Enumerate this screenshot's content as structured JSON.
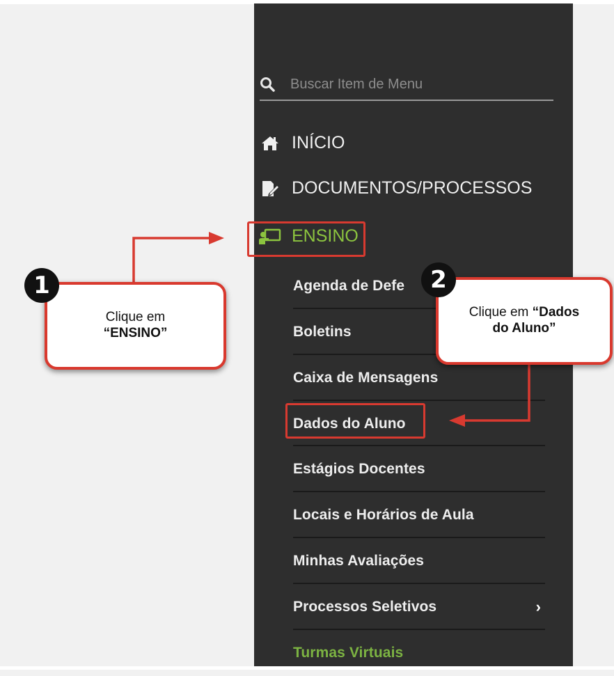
{
  "search": {
    "placeholder": "Buscar Item de Menu"
  },
  "menu": {
    "inicio": "INÍCIO",
    "documentos": "DOCUMENTOS/PROCESSOS",
    "ensino": "ENSINO"
  },
  "submenu": [
    {
      "label": "Agenda de Defe"
    },
    {
      "label": "Boletins"
    },
    {
      "label": "Caixa de Mensagens"
    },
    {
      "label": "Dados do Aluno"
    },
    {
      "label": "Estágios Docentes"
    },
    {
      "label": "Locais e Horários de Aula"
    },
    {
      "label": "Minhas Avaliações"
    },
    {
      "label": "Processos Seletivos",
      "chevron": "›"
    },
    {
      "label": "Turmas Virtuais"
    }
  ],
  "callout1": {
    "badge": "1",
    "line1": "Clique em",
    "line2": "“ENSINO”"
  },
  "callout2": {
    "badge": "2",
    "prefix": "Clique em ",
    "bold1": "“Dados",
    "bold2": "do Aluno”"
  },
  "colors": {
    "sidebar": "#2e2e2e",
    "accent_green": "#8cc43f",
    "highlight_red": "#d83a30"
  }
}
